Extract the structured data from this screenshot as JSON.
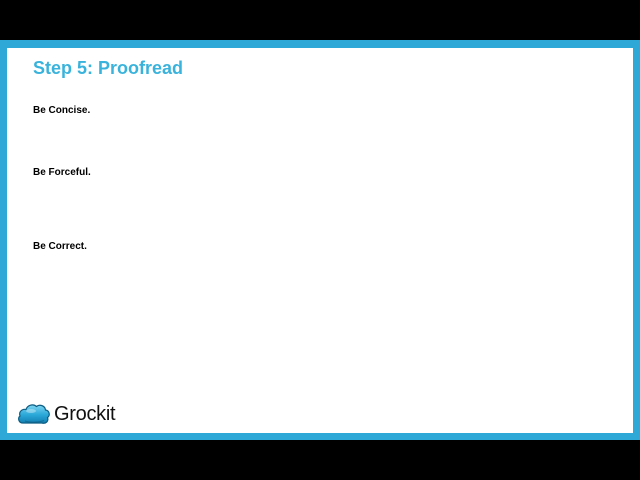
{
  "slide": {
    "title": "Step 5: Proofread",
    "bullets": [
      "Be Concise.",
      "Be Forceful.",
      "Be Correct."
    ]
  },
  "brand": {
    "name": "Grockit",
    "logo_icon": "cloud-logo-icon",
    "accent_color": "#3ab3dc",
    "frame_color": "#2ea8d6"
  }
}
